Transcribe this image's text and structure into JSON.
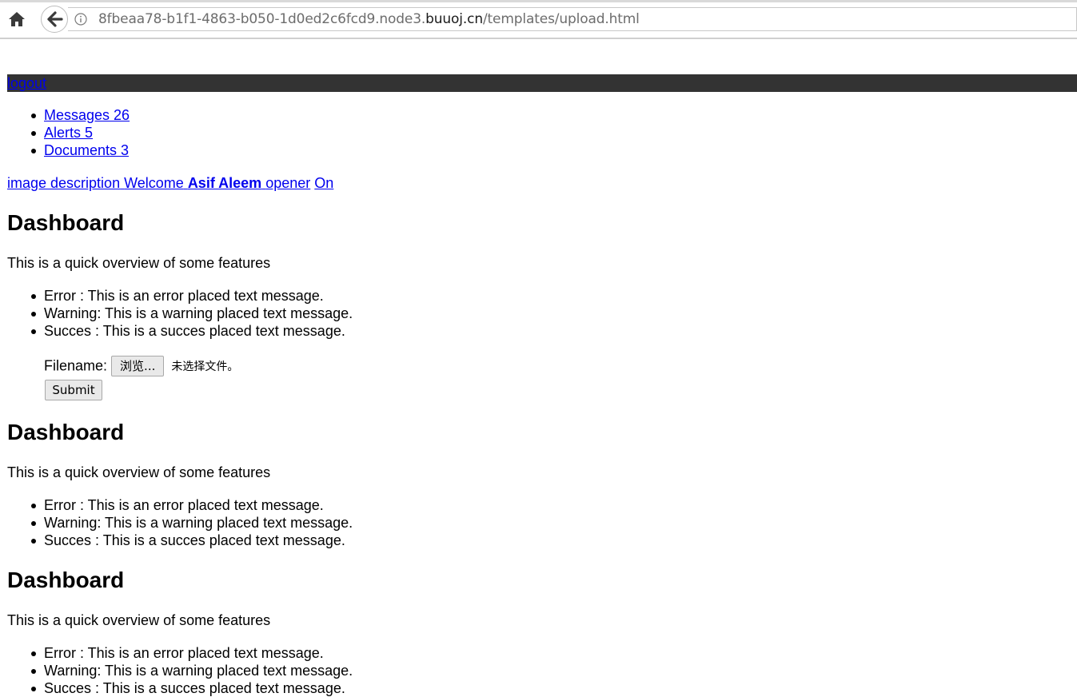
{
  "browser": {
    "url_prefix": "8fbeaa78-b1f1-4863-b050-1d0ed2c6fcd9.node3.",
    "url_domain": "buuoj.cn",
    "url_suffix": "/templates/upload.html"
  },
  "topbar": {
    "logout": "logout"
  },
  "nav": {
    "items": [
      {
        "label": "Messages 26"
      },
      {
        "label": "Alerts 5"
      },
      {
        "label": "Documents 3"
      }
    ]
  },
  "user": {
    "image_alt": "image description",
    "welcome": "Welcome",
    "name": "Asif Aleem",
    "opener": "opener",
    "on": "On"
  },
  "sections": [
    {
      "title": "Dashboard",
      "intro": "This is a quick overview of some features",
      "messages": [
        "Error : This is an error placed text message.",
        "Warning: This is a warning placed text message.",
        "Succes : This is a succes placed text message."
      ]
    },
    {
      "title": "Dashboard",
      "intro": "This is a quick overview of some features",
      "messages": [
        "Error : This is an error placed text message.",
        "Warning: This is a warning placed text message.",
        "Succes : This is a succes placed text message."
      ]
    },
    {
      "title": "Dashboard",
      "intro": "This is a quick overview of some features",
      "messages": [
        "Error : This is an error placed text message.",
        "Warning: This is a warning placed text message.",
        "Succes : This is a succes placed text message."
      ]
    }
  ],
  "form": {
    "filename_label": "Filename:",
    "browse_label": "浏览...",
    "no_file": "未选择文件。",
    "submit_label": "Submit"
  }
}
